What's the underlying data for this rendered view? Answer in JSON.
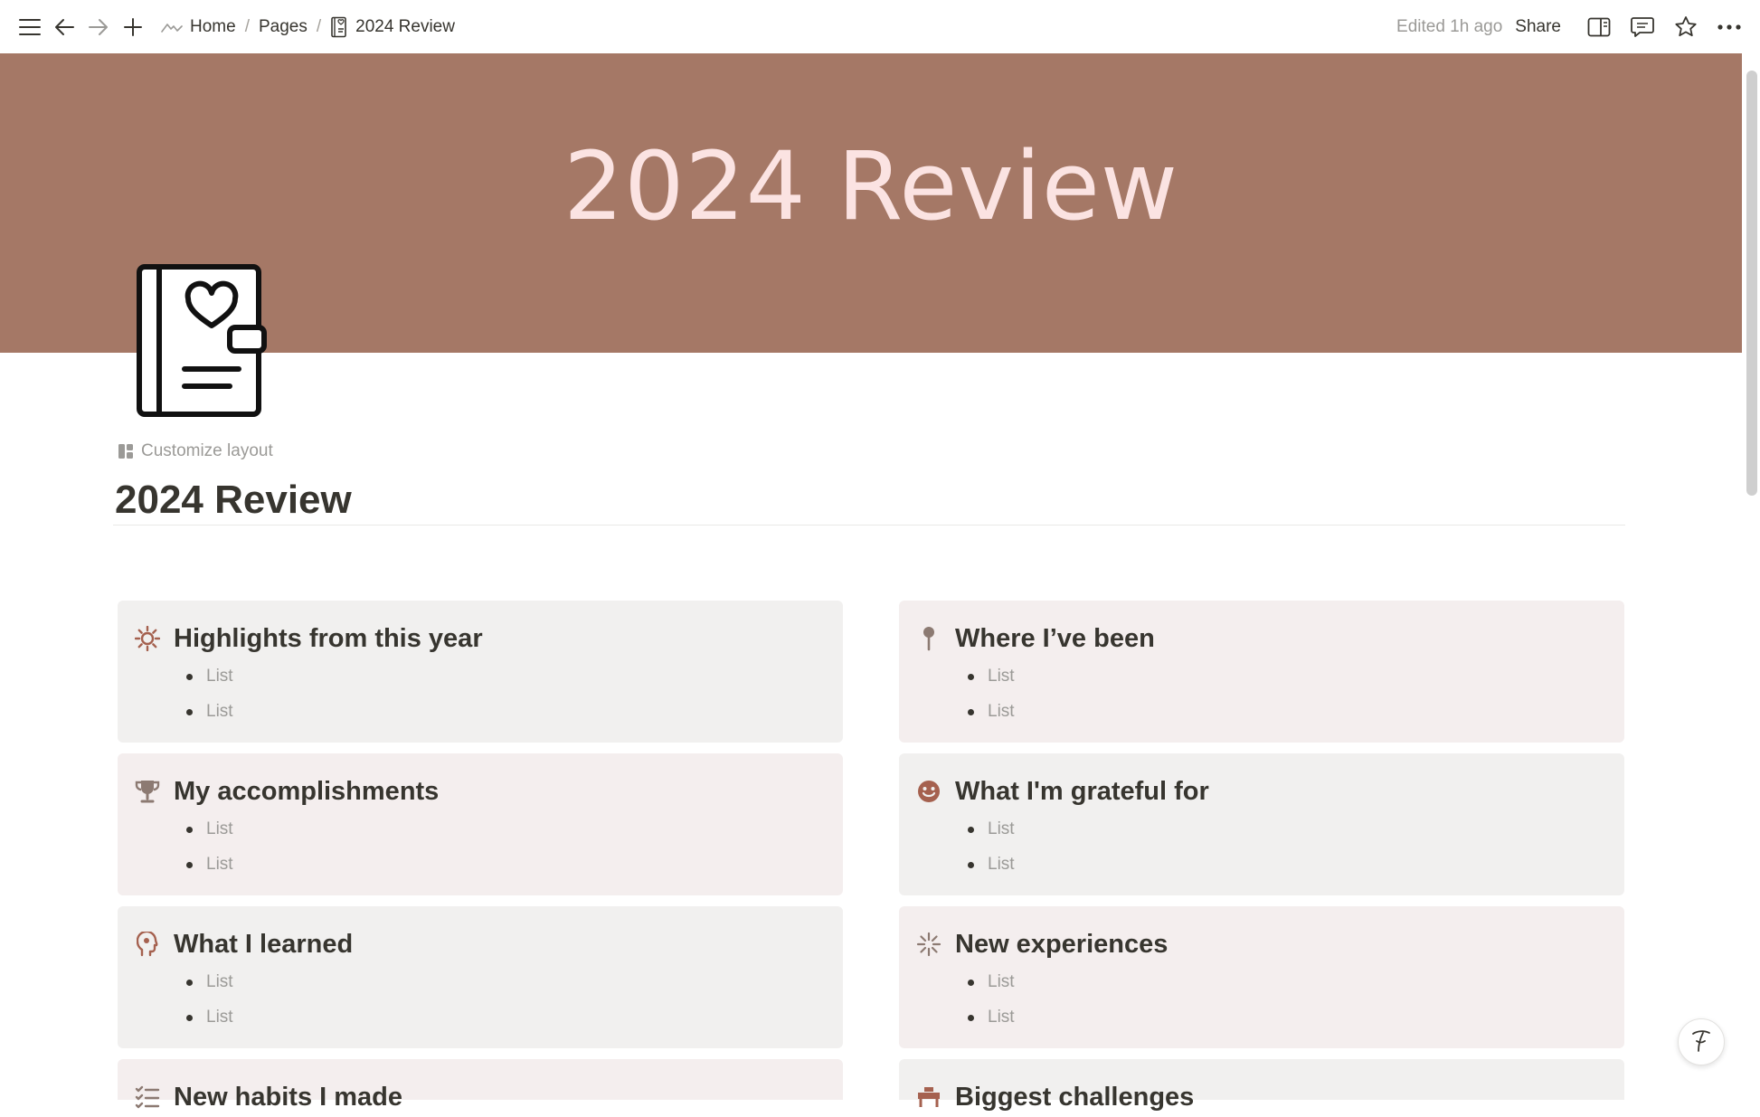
{
  "breadcrumb": {
    "home": "Home",
    "pages": "Pages",
    "current": "2024 Review",
    "separator": "/"
  },
  "header": {
    "edited": "Edited 1h ago",
    "share": "Share"
  },
  "cover": {
    "title": "2024 Review",
    "color": "#a57866",
    "text_color": "#fbe3e2"
  },
  "page": {
    "customize_label": "Customize layout",
    "title": "2024 Review"
  },
  "cards": [
    {
      "id": "highlights",
      "title": "Highlights from this year",
      "icon": "sun-icon",
      "items": [
        "List",
        "List"
      ]
    },
    {
      "id": "where-been",
      "title": "Where I’ve been",
      "icon": "pin-icon",
      "items": [
        "List",
        "List"
      ]
    },
    {
      "id": "accomplishments",
      "title": "My accomplishments",
      "icon": "trophy-icon",
      "items": [
        "List",
        "List"
      ]
    },
    {
      "id": "grateful",
      "title": "What I'm grateful for",
      "icon": "smile-icon",
      "items": [
        "List",
        "List"
      ]
    },
    {
      "id": "learned",
      "title": "What I learned",
      "icon": "brain-head-icon",
      "items": [
        "List",
        "List"
      ]
    },
    {
      "id": "experiences",
      "title": "New experiences",
      "icon": "sparkle-icon",
      "items": [
        "List",
        "List"
      ]
    },
    {
      "id": "habits",
      "title": "New habits I made",
      "icon": "checklist-icon",
      "items": []
    },
    {
      "id": "challenges",
      "title": "Biggest challenges",
      "icon": "barrier-icon",
      "items": []
    }
  ],
  "help_button": "?"
}
